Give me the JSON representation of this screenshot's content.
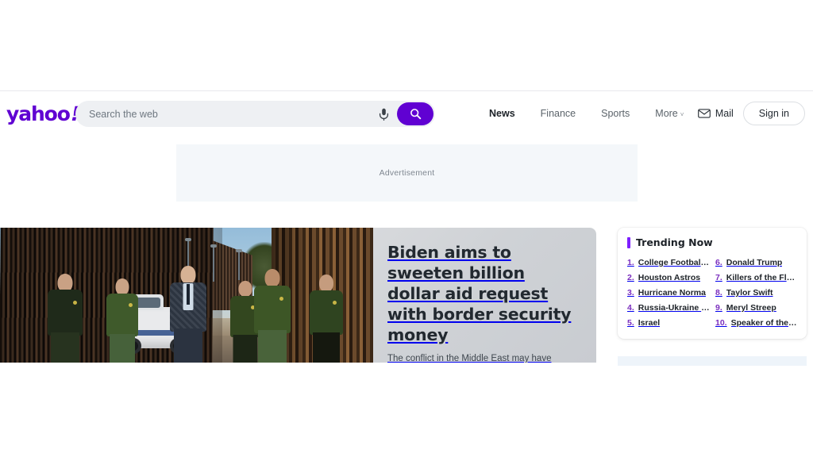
{
  "brand": {
    "logo_text": "yahoo",
    "logo_bang": "!",
    "accent_purple": "#6001d2",
    "trending_accent": "#7e1fff",
    "rank_color": "#7b2fbe"
  },
  "search": {
    "placeholder": "Search the web",
    "value": "",
    "mic_icon": "microphone-icon",
    "submit_icon": "search-icon"
  },
  "nav": {
    "items": [
      {
        "label": "News",
        "active": true
      },
      {
        "label": "Finance",
        "active": false
      },
      {
        "label": "Sports",
        "active": false
      },
      {
        "label": "More",
        "active": false,
        "caret": "˅"
      }
    ]
  },
  "account": {
    "mail_label": "Mail",
    "mail_icon": "envelope-icon",
    "signin_label": "Sign in"
  },
  "ad": {
    "label": "Advertisement"
  },
  "hero": {
    "headline": "Biden aims to sweeten billion dollar aid request with border security money",
    "summary": "The conflict in the Middle East may have pulled some of the spotlight away from the U.S.-Mexico border, but migration challenges facing",
    "image_alt": "President Biden walks with Border Patrol agents along the border wall"
  },
  "trending": {
    "title": "Trending Now",
    "left_column": [
      {
        "rank": "1.",
        "label": "College Football G..."
      },
      {
        "rank": "2.",
        "label": "Houston Astros"
      },
      {
        "rank": "3.",
        "label": "Hurricane Norma"
      },
      {
        "rank": "4.",
        "label": "Russia-Ukraine War"
      },
      {
        "rank": "5.",
        "label": "Israel"
      }
    ],
    "right_column": [
      {
        "rank": "6.",
        "label": "Donald Trump"
      },
      {
        "rank": "7.",
        "label": "Killers of the Flow..."
      },
      {
        "rank": "8.",
        "label": "Taylor Swift"
      },
      {
        "rank": "9.",
        "label": "Meryl Streep"
      },
      {
        "rank": "10.",
        "label": "Speaker of the H..."
      }
    ]
  }
}
